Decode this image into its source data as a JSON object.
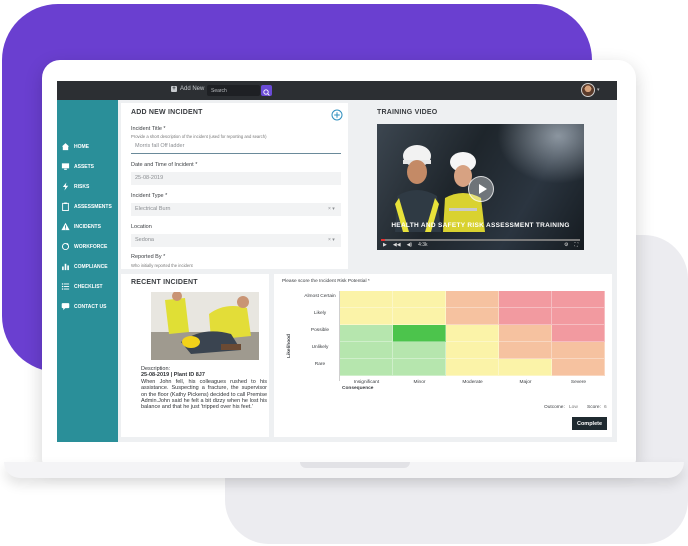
{
  "topbar": {
    "add_new": "Add New",
    "search_placeholder": "Search"
  },
  "sidebar": {
    "items": [
      {
        "label": "HOME",
        "icon": "home-icon"
      },
      {
        "label": "ASSETS",
        "icon": "monitor-icon"
      },
      {
        "label": "RISKS",
        "icon": "lightning-icon"
      },
      {
        "label": "ASSESSMENTS",
        "icon": "clipboard-icon"
      },
      {
        "label": "INCIDENTS",
        "icon": "warning-icon"
      },
      {
        "label": "WORKFORCE",
        "icon": "refresh-icon"
      },
      {
        "label": "COMPLIANCE",
        "icon": "bar-chart-icon"
      },
      {
        "label": "CHECKLIST",
        "icon": "list-icon"
      },
      {
        "label": "CONTACT US",
        "icon": "chat-icon"
      }
    ]
  },
  "add_incident": {
    "title": "ADD NEW INCIDENT",
    "incident_title_label": "Incident Title *",
    "incident_title_hint": "Provide a short description of the incident (used for reporting and search)",
    "incident_title_value": "Morris fall Off ladder",
    "datetime_label": "Date and Time of Incident *",
    "datetime_value": "25-08-2019",
    "type_label": "Incident Type *",
    "type_value": "Electrical Burn",
    "location_label": "Location",
    "location_value": "Sedona",
    "reported_by_label": "Reported By *",
    "reported_by_hint": "Who initially reported the incident",
    "clear_glyph": "× ▾"
  },
  "training_video": {
    "title": "TRAINING VIDEO",
    "caption": "HEALTH AND SAFETY RISK ASSESSMENT TRAINING",
    "progress": 0.02,
    "time": "4:3k"
  },
  "recent_incident": {
    "title": "RECENT INCIDENT",
    "desc_label": "Description:",
    "desc_meta": "25-08-2019 | Plant ID 8J7",
    "desc_text": "When John fell, his colleagues rushed to his assistance. Suspecting a fracture, the supervisor on the floor (Kathy Pickens) decided to call Premise Admin.John said he felt a bit dizzy when he lost his balance and that he just 'tripped over his feet.'"
  },
  "risk_matrix": {
    "prompt": "Please score the Incident Risk Potential *",
    "rows": [
      "Almost Certain",
      "Likely",
      "Possible",
      "Unlikely",
      "Rare"
    ],
    "cols": [
      "Insignificant",
      "Minor",
      "Moderate",
      "Major",
      "Severe"
    ],
    "y_axis": "Likelihood",
    "x_axis": "Consequence",
    "colors": {
      "green": "#b6e6ae",
      "selected": "#4cc44c",
      "yellow": "#fbf3a8",
      "orange": "#f6c2a0",
      "red": "#f29aa0"
    },
    "grid": [
      [
        "yellow",
        "yellow",
        "orange",
        "red",
        "red"
      ],
      [
        "yellow",
        "yellow",
        "orange",
        "red",
        "red"
      ],
      [
        "green",
        "selected",
        "yellow",
        "orange",
        "red"
      ],
      [
        "green",
        "green",
        "yellow",
        "orange",
        "orange"
      ],
      [
        "green",
        "green",
        "yellow",
        "yellow",
        "orange"
      ]
    ],
    "outcome_label": "Outcome:",
    "outcome_value": "Low",
    "score_label": "Score:",
    "score_value": "6",
    "complete_label": "Complete"
  }
}
